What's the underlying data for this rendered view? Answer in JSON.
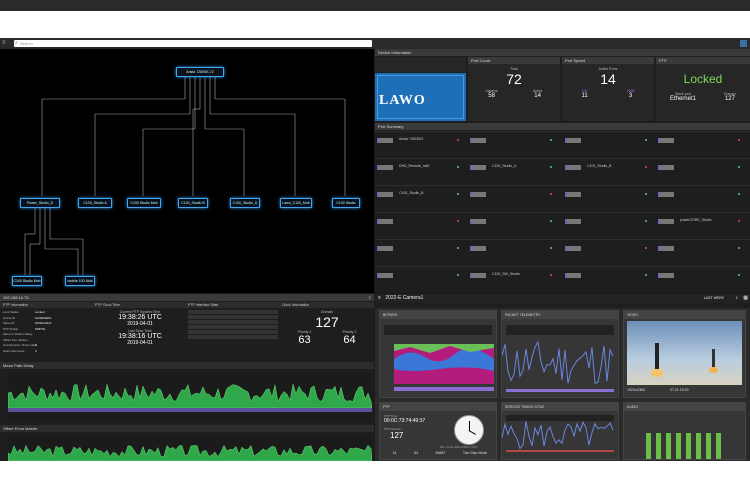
{
  "top": {
    "search_placeholder": "Search"
  },
  "topology": {
    "nodes": [
      {
        "label": "Arista 7280SE-72"
      },
      {
        "label": "Power_Studio_D"
      },
      {
        "label": "C100_Studio A"
      },
      {
        "label": "C100 Studio Mob"
      },
      {
        "label": "C100_Studio B"
      },
      {
        "label": "C100_Studio_D"
      },
      {
        "label": "Lawo_C100_Mob"
      },
      {
        "label": "C100 Studio"
      },
      {
        "label": "C100 Studio Mob"
      },
      {
        "label": "mobile 100-Mob"
      }
    ]
  },
  "device": {
    "header": "Device Information",
    "logo": "LAWO",
    "port_count": {
      "title": "Port Count",
      "total_label": "Total",
      "total": "72",
      "inactive_label": "Inactive",
      "inactive": "58",
      "active_label": "Active",
      "active": "14"
    },
    "port_speed": {
      "title": "Port Speed",
      "active_label": "Active Ports",
      "active": "14",
      "a_label": "100",
      "a": "11",
      "b_label": "1000",
      "b": "3"
    },
    "ptp": {
      "title": "PTP",
      "state": "Locked",
      "slave_label": "Slave port",
      "slave": "Ethernet1",
      "domain_label": "Domain",
      "domain": "127"
    },
    "summary_header": "Port Summary",
    "rows": [
      {
        "c1": "Arista 7060SX2",
        "c2": "",
        "c3": "",
        "c4": ""
      },
      {
        "c1": "DHD_Remote_mk5",
        "c2": "C100_Studio_A",
        "c3": "C100_Studio_B",
        "c4": ""
      },
      {
        "c1": "C100_Studio_B",
        "c2": "",
        "c3": "",
        "c4": ""
      },
      {
        "c1": "",
        "c2": "",
        "c3": "",
        "c4": "powerCORE_Studio"
      },
      {
        "c1": "",
        "c2": "",
        "c3": "",
        "c4": ""
      },
      {
        "c1": "",
        "c2": "C100_SW_Studio",
        "c3": "",
        "c4": ""
      }
    ]
  },
  "ptp_panel": {
    "ip": "192.168.10.75",
    "cols": [
      "PTP Information",
      "PTP Clock Time",
      "PTP Interface Stats",
      "Clock Information"
    ],
    "info_labels": [
      "Lock Status",
      "Grand ID",
      "Slave ID",
      "PTP Profile",
      "Slave to Master Delay",
      "Offset from Master",
      "Grandmaster Clock Class",
      "Steps Removed"
    ],
    "info_values": [
      "Locked",
      "0x0000a0b1",
      "0x00a1b2c3",
      "SMPTE",
      "",
      "",
      "6",
      "2"
    ],
    "current_label": "Current PTP System Time",
    "time1": "19:38:26 UTC",
    "date1": "2019-04-01",
    "last_sync_label": "Last Sync Time",
    "time2": "19:38:16 UTC",
    "date2": "2019-04-01",
    "domain_label": "Domain",
    "domain": "127",
    "p1_label": "Priority 1",
    "p1": "63",
    "p2_label": "Priority 2",
    "p2": "64",
    "graph1": "Mean Path Delay",
    "graph2": "Offset From Master"
  },
  "camera": {
    "title": "2022-E Camera1",
    "period": "LAST WEEK",
    "cards": {
      "bitrate": "BITRATE",
      "telemetry": "PACKET TELEMETRY",
      "video": "VIDEO",
      "ptp": "PTP",
      "timing": "SERVICE TIMING SYNC",
      "audio": "AUDIO"
    },
    "video_res": "1920x1080i",
    "video_tc": "07:21:15:20",
    "ptp_time_label": "PTP Time",
    "ptp_time": "00:0C:73:74:49:37",
    "ptp_domain_label": "PTP Domain",
    "ptp_domain": "127",
    "ptp_date": "Mon, 01 Apr 2019 19:38:27 (UTC)",
    "ptp_v1": "61",
    "ptp_v2": "64",
    "ptp_v3": "84687",
    "ptp_mode": "Two Step Mode"
  }
}
